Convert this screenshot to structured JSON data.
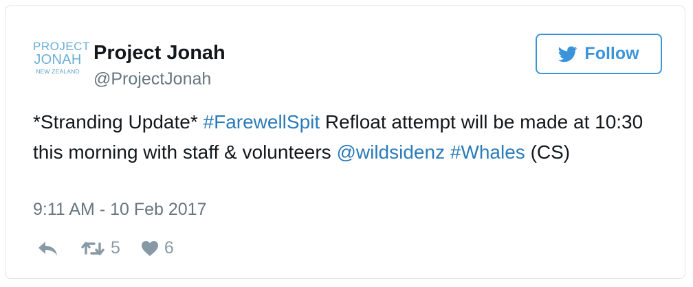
{
  "account": {
    "logo_line1": "PROJECT",
    "logo_line2": "JONAH",
    "logo_line3": "NEW ZEALAND",
    "name": "Project Jonah",
    "handle": "@ProjectJonah"
  },
  "follow_button": {
    "label": "Follow",
    "icon": "twitter-bird-icon"
  },
  "tweet": {
    "segments": [
      {
        "text": "*Stranding Update* ",
        "type": "text"
      },
      {
        "text": "#FarewellSpit",
        "type": "hashtag"
      },
      {
        "text": " Refloat attempt will be made at 10:30 this morning with staff & volunteers ",
        "type": "text"
      },
      {
        "text": "@wildsidenz",
        "type": "mention"
      },
      {
        "text": " ",
        "type": "text"
      },
      {
        "text": "#Whales",
        "type": "hashtag"
      },
      {
        "text": " (CS)",
        "type": "text"
      }
    ],
    "timestamp": "9:11 AM - 10 Feb 2017"
  },
  "actions": {
    "reply_icon": "reply-icon",
    "retweet_icon": "retweet-icon",
    "retweet_count": "5",
    "like_icon": "heart-icon",
    "like_count": "6"
  },
  "colors": {
    "link": "#2b7bb9",
    "follow_border": "#3b94d9",
    "muted": "#66757f",
    "icon": "#8899a6"
  }
}
